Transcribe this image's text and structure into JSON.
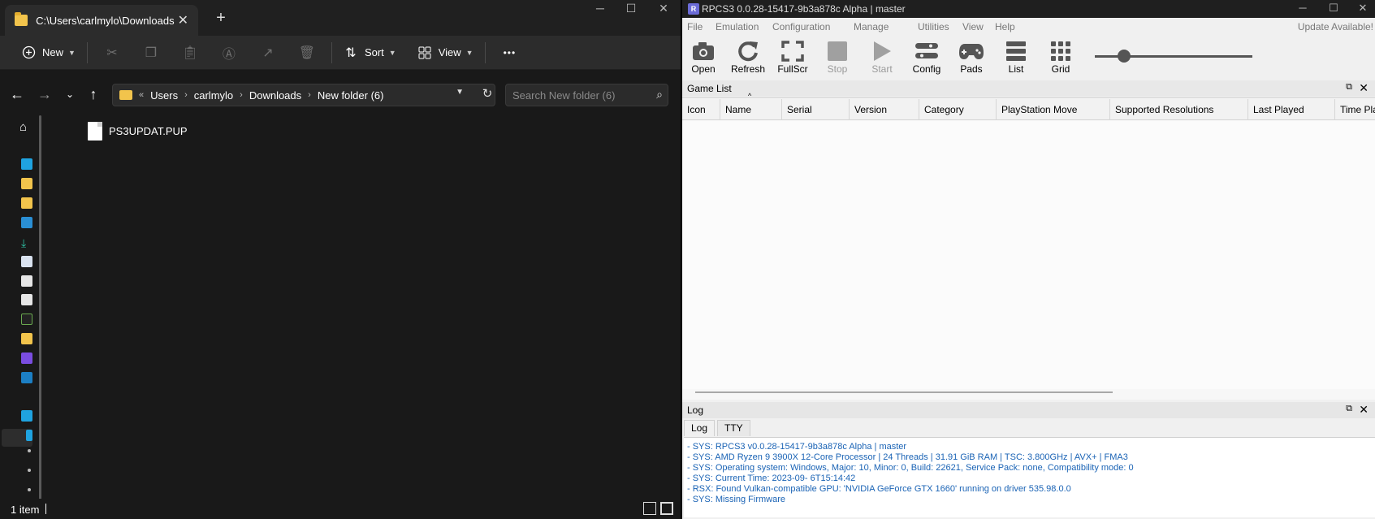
{
  "explorer": {
    "tab_title": "C:\\Users\\carlmylo\\Downloads",
    "new_tab_glyph": "+",
    "toolbar": {
      "new_label": "New",
      "sort_label": "Sort",
      "view_label": "View",
      "more_glyph": "•••"
    },
    "breadcrumb": {
      "overflow": "«",
      "items": [
        "Users",
        "carlmylo",
        "Downloads",
        "New folder (6)"
      ]
    },
    "search_placeholder": "Search New folder (6)",
    "files": [
      {
        "name": "PS3UPDAT.PUP",
        "icon": "file-icon"
      }
    ],
    "status": {
      "count": "1 item"
    }
  },
  "rpcs3": {
    "window_title": "RPCS3 0.0.28-15417-9b3a878c Alpha | master",
    "logo_glyph": "R",
    "menu": [
      "File",
      "Emulation",
      "Configuration",
      "Manage",
      "Utilities",
      "View",
      "Help"
    ],
    "update_label": "Update Available!",
    "toolbar": [
      "Open",
      "Refresh",
      "FullScr",
      "Stop",
      "Start",
      "Config",
      "Pads",
      "List",
      "Grid"
    ],
    "toolbar_more": "»",
    "game_list": {
      "title": "Game List",
      "columns": [
        "Icon",
        "Name",
        "Serial",
        "Version",
        "Category",
        "PlayStation Move",
        "Supported Resolutions",
        "Last Played",
        "Time Played"
      ],
      "sort_glyph": "^"
    },
    "log": {
      "title": "Log",
      "tabs": [
        "Log",
        "TTY"
      ],
      "lines": [
        "- SYS: RPCS3 v0.0.28-15417-9b3a878c Alpha | master",
        "- SYS: AMD Ryzen 9 3900X 12-Core Processor | 24 Threads | 31.91 GiB RAM | TSC: 3.800GHz | AVX+ | FMA3",
        "- SYS: Operating system: Windows, Major: 10, Minor: 0, Build: 22621, Service Pack: none, Compatibility mode: 0",
        "- SYS: Current Time: 2023-09- 6T15:14:42",
        "- RSX: Found Vulkan-compatible GPU: 'NVIDIA GeForce GTX 1660' running on driver 535.98.0.0",
        "- SYS: Missing Firmware"
      ]
    }
  }
}
